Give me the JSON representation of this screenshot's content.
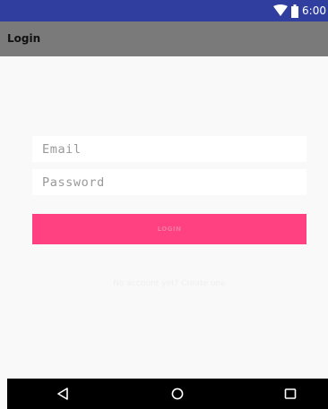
{
  "status_bar": {
    "time": "6:00",
    "background": "#303f9f",
    "icons": [
      "wifi-icon",
      "battery-icon"
    ]
  },
  "app_bar": {
    "title": "Login",
    "background": "#7a7a7a"
  },
  "form": {
    "email_placeholder": "Email",
    "email_value": "",
    "password_placeholder": "Password",
    "password_value": "",
    "login_label": "LOGIN",
    "login_color": "#ff4081",
    "signup_link": "No account yet? Create one"
  },
  "nav_bar": {
    "buttons": [
      "back-icon",
      "home-icon",
      "recents-icon"
    ]
  }
}
